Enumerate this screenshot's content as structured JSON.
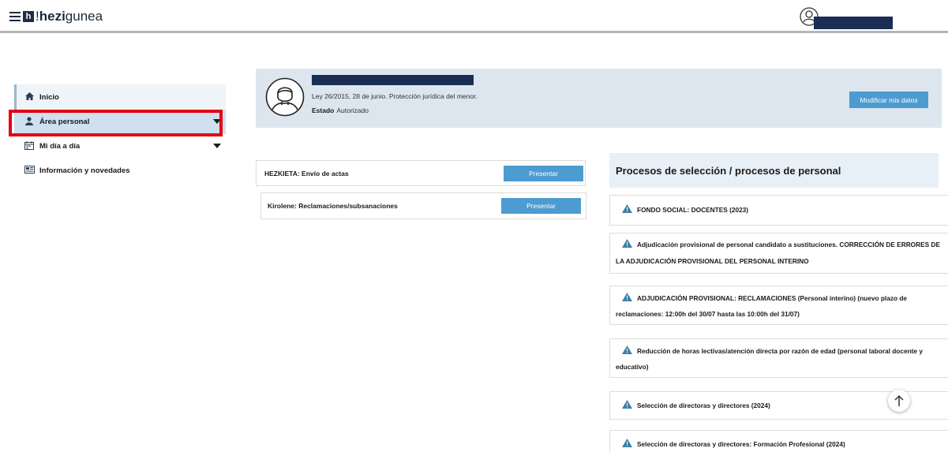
{
  "header": {
    "logo_prefix": "",
    "logo_bold": "hezi",
    "logo_rest": "gunea",
    "logo_letter": "h",
    "logo_bang": "!"
  },
  "sidebar": {
    "items": [
      {
        "label": "Inicio",
        "icon": "home-icon"
      },
      {
        "label": "Área personal",
        "icon": "user-icon"
      },
      {
        "label": "Mi día a día",
        "icon": "calendar-icon"
      },
      {
        "label": "Información y novedades",
        "icon": "news-icon"
      }
    ]
  },
  "profile": {
    "law": "Ley 26/2015, 28 de junio. Protección jurídica del menor.",
    "status_label": "Estado",
    "status_value": "Autorizado",
    "modify_button": "Modificar mis datos"
  },
  "actions": [
    {
      "label": "HEZKIETA: Envío de actas",
      "button": "Presentar"
    },
    {
      "label": "Kirolene: Reclamaciones/subsanaciones",
      "button": "Presentar"
    }
  ],
  "processes": {
    "title": "Procesos de selección / procesos de personal",
    "items": [
      "FONDO SOCIAL: DOCENTES (2023)",
      "Adjudicación provisional de personal candidato a sustituciones. CORRECCIÓN DE ERRORES DE LA ADJUDICACIÓN PROVISIONAL DEL PERSONAL INTERINO",
      "ADJUDICACIÓN PROVISIONAL: RECLAMACIONES (Personal interino) (nuevo plazo de reclamaciones: 12:00h del 30/07 hasta las 10:00h del 31/07)",
      "Reducción de horas lectivas/atención directa por razón de edad (personal laboral docente y educativo)",
      "Selección de directoras y directores (2024)",
      "Selección de directoras y directores: Formación Profesional (2024)"
    ]
  },
  "colors": {
    "accent_button": "#4d9bd0",
    "highlight_border": "#e60012",
    "redaction": "#1a2d55",
    "warning_icon": "#3d7fa6"
  }
}
